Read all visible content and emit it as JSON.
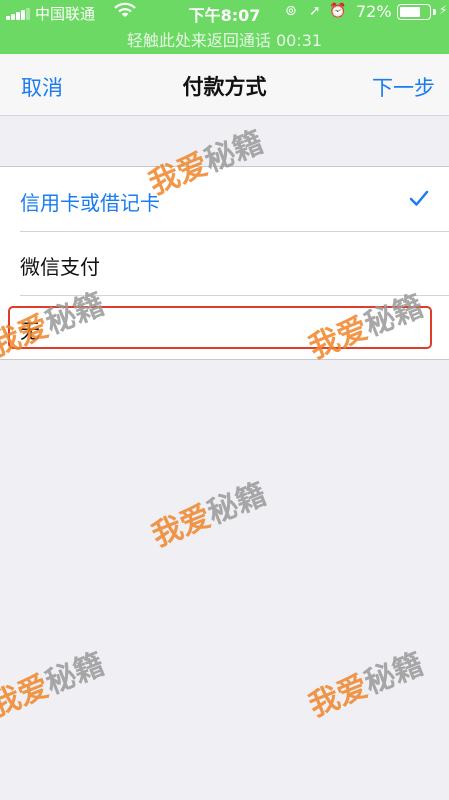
{
  "status_bar": {
    "carrier": "中国联通",
    "time": "下午8:07",
    "battery_percent": "72%",
    "battery_level": 0.72,
    "icons": [
      "signal-icon",
      "wifi-icon",
      "screen-lock-icon",
      "location-icon",
      "alarm-icon",
      "battery-icon",
      "charging-icon"
    ]
  },
  "call_banner": "轻触此处来返回通话 00:31",
  "nav": {
    "cancel_label": "取消",
    "title": "付款方式",
    "next_label": "下一步"
  },
  "options": [
    {
      "label": "信用卡或借记卡",
      "selected": true
    },
    {
      "label": "微信支付",
      "selected": false
    },
    {
      "label": "无",
      "selected": false
    }
  ],
  "watermark": {
    "part1": "我爱",
    "part2": "秘籍"
  },
  "colors": {
    "accent": "#1a7cf0",
    "status_bar": "#6cd964",
    "highlight": "#e03c2a",
    "watermark_orange": "#f0862a"
  }
}
